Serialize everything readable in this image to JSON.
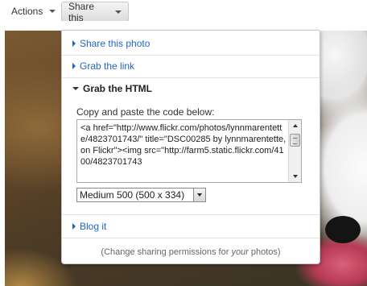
{
  "toolbar": {
    "actions_label": "Actions",
    "share_label": "Share this"
  },
  "panel": {
    "share_photo": "Share this photo",
    "grab_link": "Grab the link",
    "grab_html": "Grab the HTML",
    "copy_label": "Copy and paste the code below:",
    "code": "<a href=\"http://www.flickr.com/photos/lynnmarentette/4823701743/\" title=\"DSC00285 by lynnmarentette, on Flickr\"><img src=\"http://farm5.static.flickr.com/4100/4823701743",
    "size_selected": "Medium 500 (500 x 334)",
    "blog_it": "Blog it",
    "footer_before": "(Change sharing permissions for ",
    "footer_em": "your",
    "footer_after": " photos)"
  },
  "colors": {
    "link": "#1f66c1",
    "panel_border": "#c8c8c8"
  },
  "icons": {
    "menu_caret": "caret-down-icon",
    "expand": "triangle-right-icon",
    "collapse": "triangle-down-icon"
  }
}
